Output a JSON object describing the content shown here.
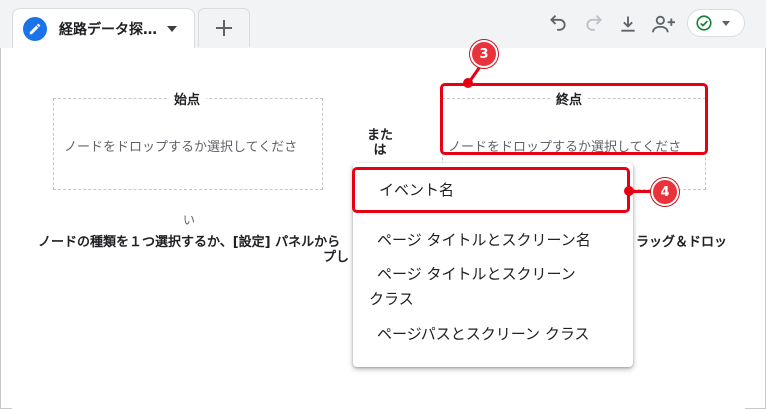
{
  "tab": {
    "title": "経路データ探…",
    "icon": "pencil-icon"
  },
  "add_tab": {
    "label": "+"
  },
  "toolbar": {
    "icons": [
      "undo-icon",
      "redo-icon",
      "download-icon",
      "share-user-icon",
      "check-circle-icon"
    ]
  },
  "start_node": {
    "label": "始点",
    "hint": "ノードをドロップするか選択してくださ"
  },
  "end_node": {
    "label": "終点",
    "hint": "ノードをドロップするか選択してくださ"
  },
  "connector": {
    "line1": "また",
    "line2": "は"
  },
  "instructions": {
    "wrap": "い",
    "line1_left": "ノードの種類を１つ選択するか、[設定] パネルから",
    "line1_right": "ラッグ＆ドロッ",
    "line2": "プし"
  },
  "menu": {
    "items": [
      {
        "label": "イベント名"
      },
      {
        "label": "ページ タイトルとスクリーン名"
      },
      {
        "label_line1": "ページ タイトルとスクリーン",
        "label_line2": "クラス"
      },
      {
        "label": "ページパスとスクリーン クラス"
      }
    ]
  },
  "callouts": {
    "step3": "3",
    "step4": "4"
  },
  "colors": {
    "accent": "#1a73e8",
    "highlight": "#e60012",
    "success": "#188038"
  }
}
